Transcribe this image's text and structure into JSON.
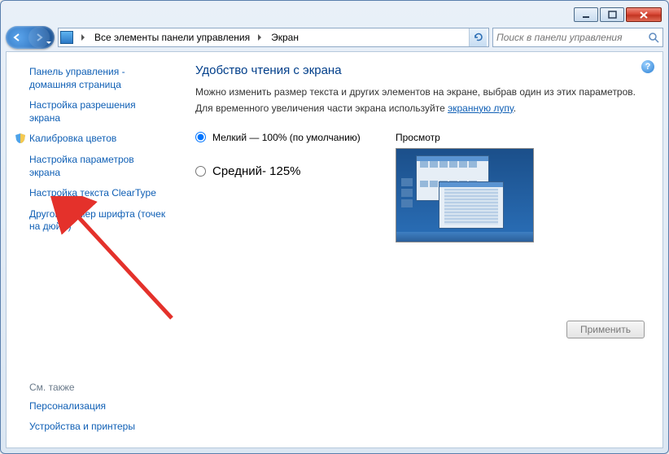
{
  "breadcrumb": {
    "item1": "Все элементы панели управления",
    "item2": "Экран"
  },
  "search": {
    "placeholder": "Поиск в панели управления"
  },
  "sidebar": {
    "home": "Панель управления - домашняя страница",
    "resolution": "Настройка разрешения экрана",
    "calibrate": "Калибровка цветов",
    "params": "Настройка параметров экрана",
    "cleartype": "Настройка текста ClearType",
    "dpi": "Другой размер шрифта (точек на дюйм)",
    "see_also_label": "См. также",
    "personalization": "Персонализация",
    "devices": "Устройства и принтеры"
  },
  "main": {
    "heading": "Удобство чтения с экрана",
    "desc_line1": "Можно изменить размер текста и других элементов на экране, выбрав один из этих параметров.",
    "desc_line2_a": "Для временного увеличения части экрана используйте ",
    "desc_line2_link": "экранную лупу",
    "desc_line2_b": ".",
    "option_small": "Мелкий — 100% (по умолчанию)",
    "option_medium": "Средний- 125%",
    "preview_label": "Просмотр",
    "apply": "Применить"
  },
  "help_symbol": "?"
}
